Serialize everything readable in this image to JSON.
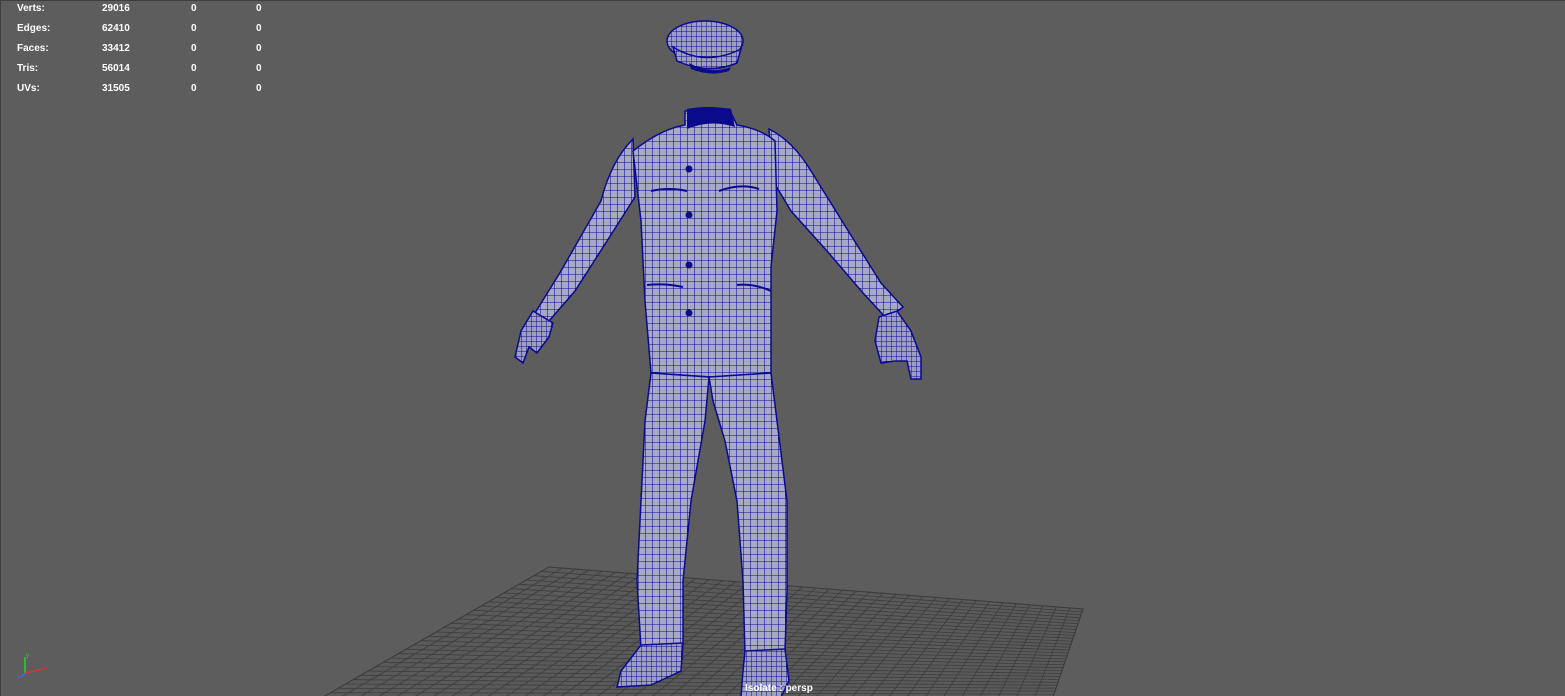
{
  "hud": {
    "rows": [
      {
        "label": "Verts:",
        "total": "29016",
        "selected": "0",
        "components": "0"
      },
      {
        "label": "Edges:",
        "total": "62410",
        "selected": "0",
        "components": "0"
      },
      {
        "label": "Faces:",
        "total": "33412",
        "selected": "0",
        "components": "0"
      },
      {
        "label": "Tris:",
        "total": "56014",
        "selected": "0",
        "components": "0"
      },
      {
        "label": "UVs:",
        "total": "31505",
        "selected": "0",
        "components": "0"
      }
    ]
  },
  "viewport": {
    "camera_label": "Isolate : persp",
    "background_color": "#5d5d5d",
    "wireframe_color": "#0a0a8c",
    "surface_color": "#a6a6c8",
    "grid_color": "#3f3f3f"
  },
  "axis_gizmo": {
    "x_color": "#e03030",
    "y_color": "#30d030",
    "z_color": "#3070ff"
  },
  "model": {
    "icon": "uniform-wireframe-model"
  }
}
